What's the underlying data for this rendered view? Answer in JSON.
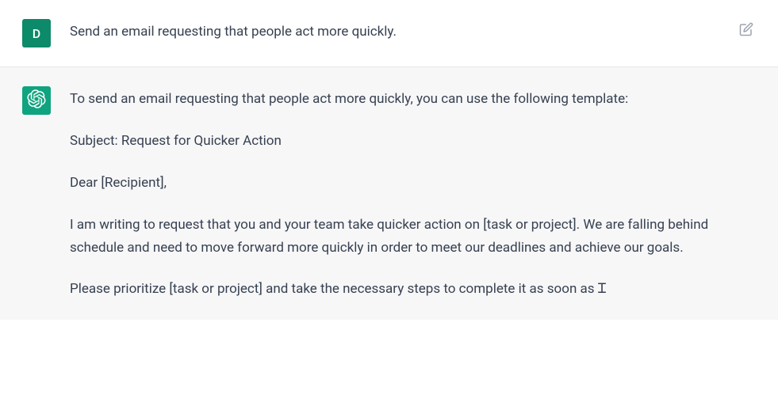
{
  "user": {
    "avatar_initial": "D",
    "message": "Send an email requesting that people act more quickly."
  },
  "assistant": {
    "paragraphs": [
      "To send an email requesting that people act more quickly, you can use the following template:",
      "Subject: Request for Quicker Action",
      "Dear [Recipient],",
      "I am writing to request that you and your team take quicker action on [task or project]. We are falling behind schedule and need to move forward more quickly in order to meet our deadlines and achieve our goals.",
      "Please prioritize [task or project] and take the necessary steps to complete it as soon as"
    ]
  },
  "icons": {
    "edit": "edit-icon",
    "assistant_logo": "openai-logo-icon"
  }
}
